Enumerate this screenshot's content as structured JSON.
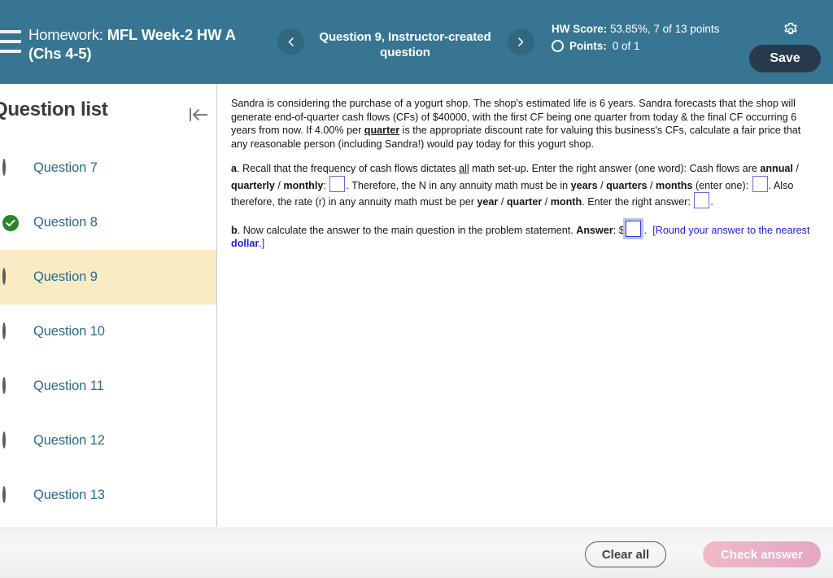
{
  "header": {
    "menu_icon": "hamburger-menu-icon",
    "homework_label": "Homework:",
    "homework_name": "MFL Week-2 HW A (Chs 4-5)",
    "prev_icon": "chevron-left-icon",
    "next_icon": "chevron-right-icon",
    "question_label": "Question 9, Instructor-created question",
    "hw_score_label": "HW Score:",
    "hw_score_value": "53.85%, 7 of 13 points",
    "points_label": "Points:",
    "points_value": "0 of 1",
    "gear_icon": "gear-icon",
    "save_label": "Save",
    "bar_color": "#377593",
    "save_color": "#273b4d"
  },
  "sidebar": {
    "title": "Question list",
    "collapse_icon": "collapse-left-icon",
    "items": [
      {
        "label": "Question 7",
        "state": "unanswered"
      },
      {
        "label": "Question 8",
        "state": "correct"
      },
      {
        "label": "Question 9",
        "state": "unanswered",
        "active": true
      },
      {
        "label": "Question 10",
        "state": "unanswered"
      },
      {
        "label": "Question 11",
        "state": "unanswered"
      },
      {
        "label": "Question 12",
        "state": "unanswered"
      },
      {
        "label": "Question 13",
        "state": "unanswered"
      }
    ],
    "active_bg": "#f9ebc4",
    "correct_color": "#27862a",
    "link_color": "#2a6b8a"
  },
  "question": {
    "stem_1": "Sandra is considering the purchase of a yogurt shop. The shop's estimated life is 6 years. Sandra forecasts that the shop will generate end-of-quarter cash flows (CFs) of $40000, with the first CF being one quarter from today & the final CF occurring 6 years from now. If 4.00% per ",
    "stem_underlined": "quarter",
    "stem_2": " is the appropriate discount rate for valuing this business's CFs, calculate a fair price that any reasonable person (including Sandra!) would pay today for this yogurt shop.",
    "part_a": {
      "marker": "a",
      "t1": ". Recall that the frequency of cash flows dictates ",
      "t_all": "all",
      "t2": " math set-up. Enter the right answer (one word): Cash flows are ",
      "opt1": "annual",
      "sep1": " / ",
      "opt2": "quarterly",
      "sep2": " / ",
      "opt3": "monthly",
      "t3": ": ",
      "input_1": "",
      "t4": ". Therefore, the N in any annuity math must be in ",
      "opt4": "years",
      "opt5": "quarters",
      "opt6": "months",
      "t5": " (enter one): ",
      "input_2": "",
      "t6": ". Also therefore, the rate (r) in any annuity math must be per ",
      "opt7": "year",
      "opt8": "quarter",
      "opt9": "month",
      "t7": ". Enter the right answer: ",
      "input_3": "",
      "t8": "."
    },
    "part_b": {
      "marker": "b",
      "t1": ". Now calculate the answer to the main question in the problem statement. ",
      "answer_label": "Answer",
      "t2": ": $",
      "input_value": "",
      "t3": ".",
      "note_1": "[Round your answer to the nearest ",
      "note_bold": "dollar",
      "note_2": ".]"
    }
  },
  "footer": {
    "clear_label": "Clear all",
    "check_label": "Check answer",
    "check_color": "#e8b0c4"
  }
}
